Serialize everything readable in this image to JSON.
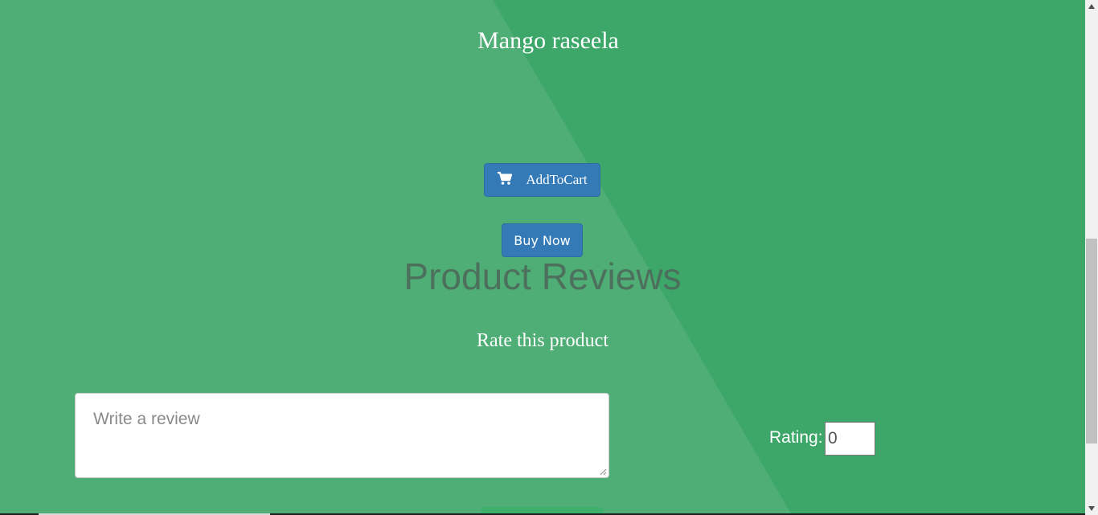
{
  "product": {
    "title": "Mango raseela"
  },
  "actions": {
    "add_to_cart_label": "AddToCart",
    "buy_now_label": "Buy Now",
    "cart_icon": "shopping-cart-icon"
  },
  "reviews": {
    "heading": "Product Reviews",
    "rate_label": "Rate this product",
    "review_placeholder": "Write a review",
    "rating_label": "Rating:",
    "rating_value": "0"
  },
  "colors": {
    "background": "#3ca768",
    "diagonal_light": "#4fae76",
    "button_primary": "#337ab7",
    "heading_muted": "#4d6a5b"
  }
}
